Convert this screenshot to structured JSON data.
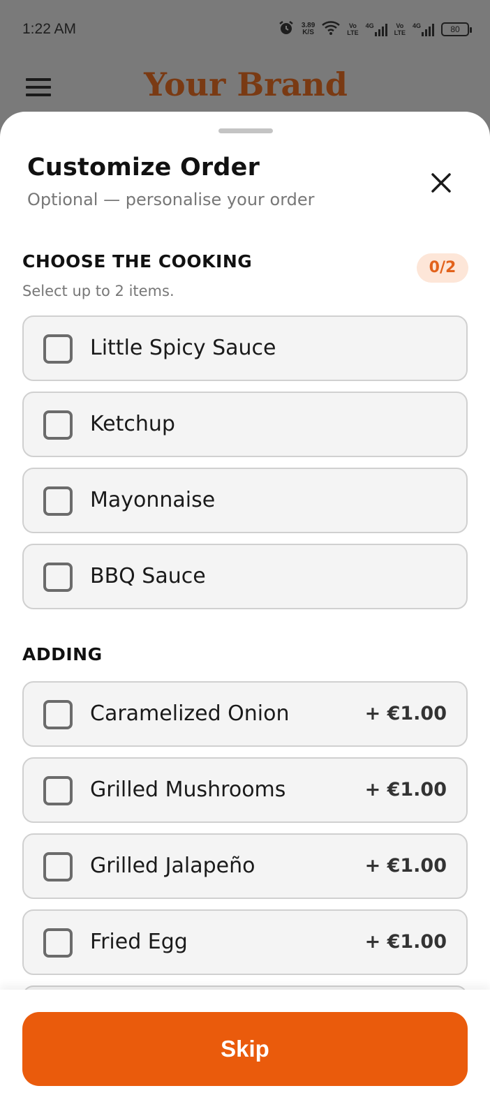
{
  "status_bar": {
    "time": "1:22 AM",
    "net_speed_value": "3.89",
    "net_speed_unit": "K/S",
    "sim1": {
      "volte": "Vo",
      "lte": "LTE",
      "gen": "4G"
    },
    "sim2": {
      "volte": "Vo",
      "lte": "LTE",
      "gen": "4G"
    },
    "battery": "80"
  },
  "app_bar": {
    "brand": "Your Brand",
    "brand_color": "#7a3a13"
  },
  "sheet": {
    "title": "Customize Order",
    "subtitle": "Optional — personalise your order",
    "sections": [
      {
        "title": "CHOOSE THE COOKING",
        "hint": "Select up to 2 items.",
        "count": "0/2",
        "options": [
          {
            "label": "Little Spicy Sauce",
            "checked": false
          },
          {
            "label": "Ketchup",
            "checked": false
          },
          {
            "label": "Mayonnaise",
            "checked": false
          },
          {
            "label": "BBQ Sauce",
            "checked": false
          }
        ]
      },
      {
        "title": "ADDING",
        "options": [
          {
            "label": "Caramelized Onion",
            "price": "+ €1.00",
            "checked": false
          },
          {
            "label": "Grilled Mushrooms",
            "price": "+ €1.00",
            "checked": false
          },
          {
            "label": "Grilled Jalapeño",
            "price": "+ €1.00",
            "checked": false
          },
          {
            "label": "Fried Egg",
            "price": "+ €1.00",
            "checked": false
          }
        ]
      }
    ]
  },
  "footer": {
    "skip_label": "Skip",
    "accent_color": "#ea5b0c"
  }
}
